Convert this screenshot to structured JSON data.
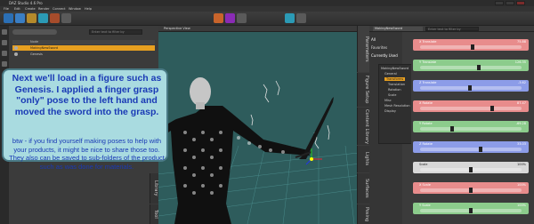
{
  "app": {
    "title": "DAZ Studio 4.6 Pro"
  },
  "menu": [
    "File",
    "Edit",
    "Create",
    "Render",
    "Connect",
    "Window",
    "Help"
  ],
  "toolbar": {
    "tools": [
      "select-tool",
      "node-selection-tool",
      "universal-tool",
      "active-pose-tool",
      "rotate-tool",
      "translate-tool",
      "scale-tool",
      "spot-render-tool",
      "surface-selection-tool"
    ]
  },
  "scene": {
    "filter_placeholder": "Enter text to filter by",
    "header_label": "Node",
    "rows": [
      {
        "label": "MakingNewSword",
        "selected": true
      },
      {
        "label": "Genesis",
        "selected": false
      }
    ]
  },
  "left_tabs": [
    "Library",
    "Tool"
  ],
  "viewport": {
    "camera": "Perspective View"
  },
  "parameters": {
    "node_select": "MakingNewSword",
    "filter_placeholder": "Enter text to filter by",
    "list": [
      "All",
      "Favorites",
      "Currently Used"
    ],
    "tree": [
      "MakingNewSword",
      "General",
      "Transforms",
      "Translation",
      "Rotation",
      "Scale",
      "Misc",
      "Mesh Resolution",
      "Display"
    ],
    "side_tabs": [
      "Parameters",
      "Figure Setup",
      "Content Library",
      "Lights",
      "Surfaces",
      "Posing"
    ],
    "sliders": [
      {
        "label": "X Translate",
        "value": "75.88",
        "color": "#e88c8c",
        "knob": 0.52
      },
      {
        "label": "Y Translate",
        "value": "126.35",
        "color": "#8ccc8c",
        "knob": 0.58
      },
      {
        "label": "Z Translate",
        "value": "-3.62",
        "color": "#8c9ce8",
        "knob": 0.49
      },
      {
        "label": "X Rotate",
        "value": "87.47",
        "color": "#e88c8c",
        "knob": 0.72
      },
      {
        "label": "Y Rotate",
        "value": "-69.28",
        "color": "#8ccc8c",
        "knob": 0.31
      },
      {
        "label": "Z Rotate",
        "value": "33.03",
        "color": "#8c9ce8",
        "knob": 0.6
      },
      {
        "label": "Scale",
        "value": "100%",
        "color": "#d8d8d8",
        "knob": 0.5
      },
      {
        "label": "X Scale",
        "value": "100%",
        "color": "#e88c8c",
        "knob": 0.5
      },
      {
        "label": "Y Scale",
        "value": "100%",
        "color": "#8ccc8c",
        "knob": 0.5
      }
    ]
  },
  "callout": {
    "main": "Next we'll load in a figure such as Genesis. I applied a finger grasp \"only\" pose to the left hand and moved the sword into the grasp.",
    "note": "btw - if you find yourself making poses to help with your products, it might be nice to share those too. They also can be saved to sub-folders of the product such as was done for materials."
  }
}
